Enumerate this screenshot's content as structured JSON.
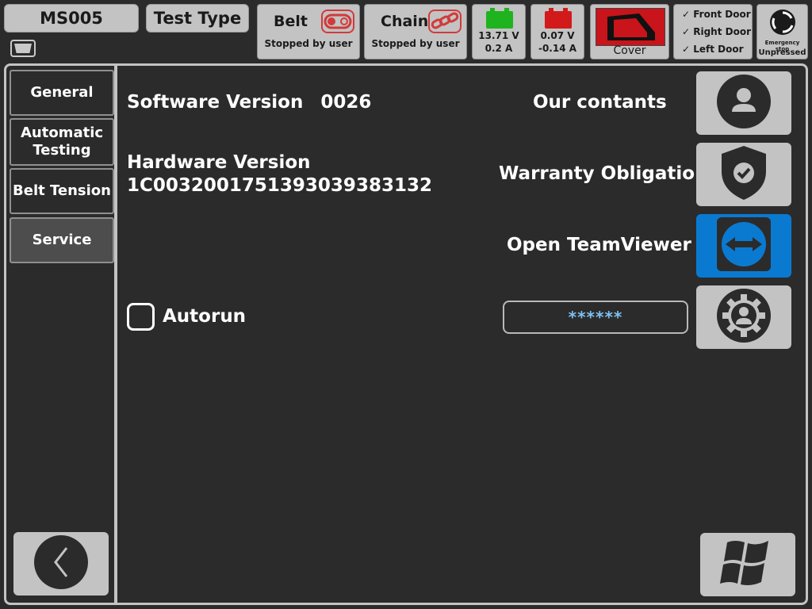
{
  "header": {
    "machine_id": "MS005",
    "test_type_label": "Test Type",
    "belt": {
      "title": "Belt",
      "status": "Stopped by user"
    },
    "chain": {
      "title": "Chain",
      "status": "Stopped by user"
    },
    "battery1": {
      "voltage": "13.71 V",
      "current": "0.2 A",
      "color": "#1fb31f"
    },
    "battery2": {
      "voltage": "0.07 V",
      "current": "-0.14 A",
      "color": "#d21a1a"
    },
    "cover": {
      "label": "Cover"
    },
    "doors": [
      "✓ Front Door",
      "✓ Right Door",
      "✓ Left Door"
    ],
    "emergency_stop": {
      "title": "Emergency stop",
      "state": "Unpressed"
    }
  },
  "sidebar": {
    "items": [
      {
        "label": "General"
      },
      {
        "label": "Automatic Testing"
      },
      {
        "label": "Belt Tension"
      },
      {
        "label": "Service"
      }
    ]
  },
  "main": {
    "software_version_label": "Software Version",
    "software_version_value": "0026",
    "hardware_version_label": "Hardware Version",
    "hardware_version_value": "1C003200175139303938​3132",
    "autorun_label": "Autorun",
    "contacts_label": "Our contants",
    "warranty_label": "Warranty Obligation",
    "teamviewer_label": "Open TeamViewer",
    "password_value": "******"
  },
  "colors": {
    "accent_blue": "#0a7ad1",
    "panel_gray": "#c3c3c3",
    "background": "#2b2b2c"
  }
}
